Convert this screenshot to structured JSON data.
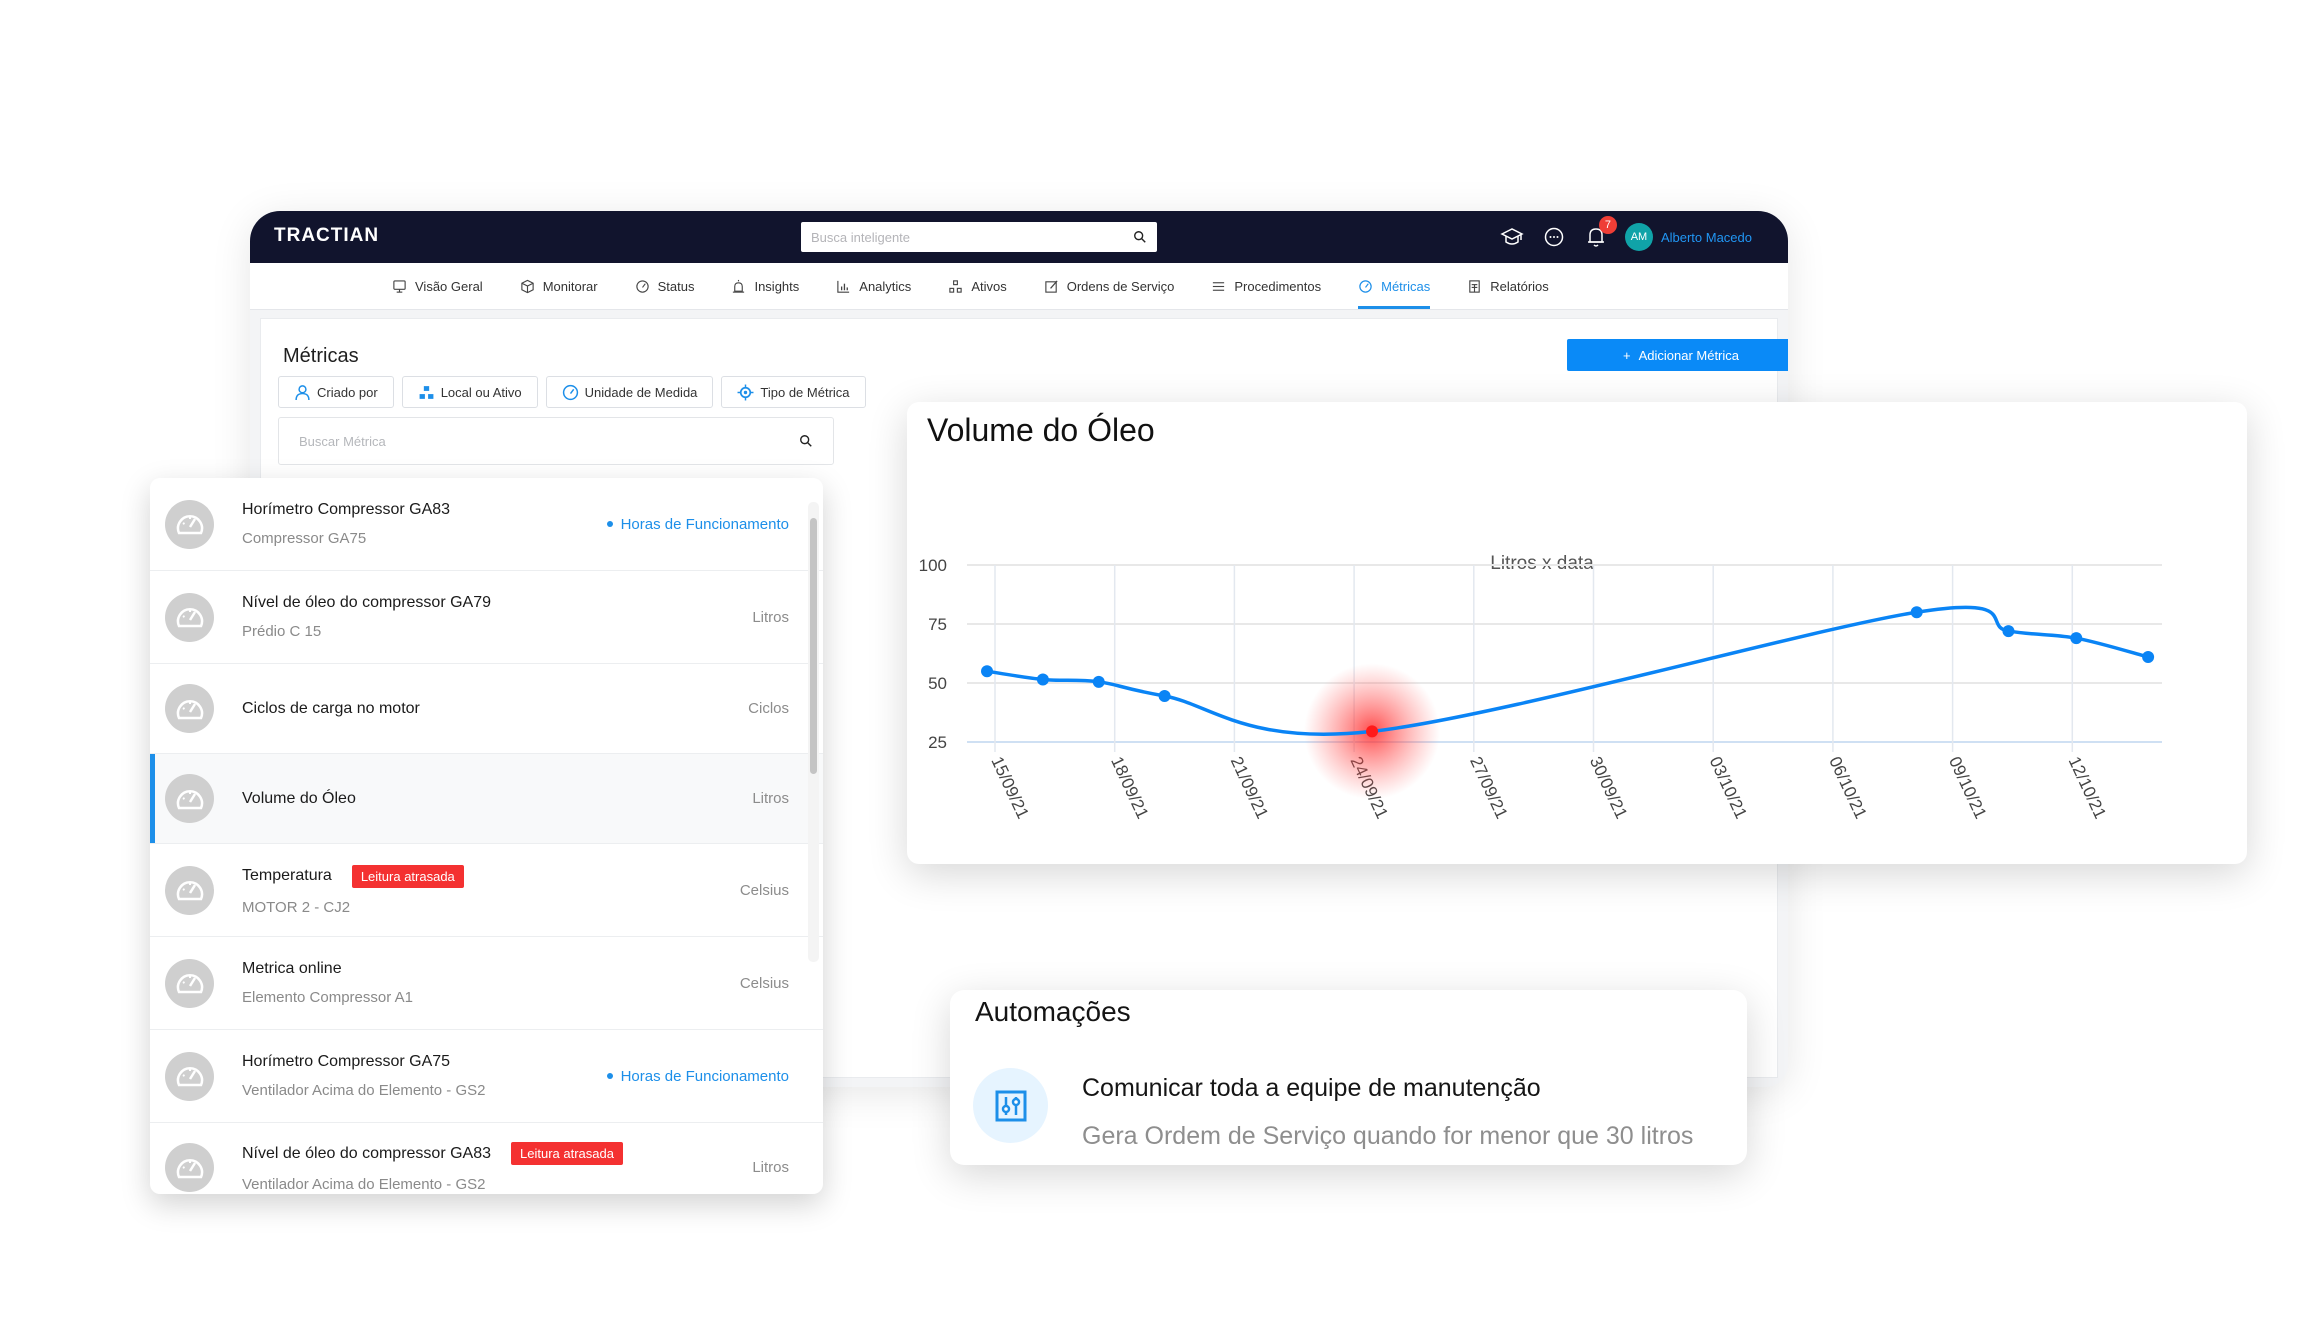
{
  "app": {
    "logo": "TRACTIAN",
    "search_placeholder": "Busca inteligente",
    "notifications_count": "7",
    "user_initials": "AM",
    "user_name": "Alberto Macedo"
  },
  "nav": [
    {
      "label": "Visão Geral",
      "icon": "monitor-icon"
    },
    {
      "label": "Monitorar",
      "icon": "cube-icon"
    },
    {
      "label": "Status",
      "icon": "gauge-icon"
    },
    {
      "label": "Insights",
      "icon": "alarm-icon"
    },
    {
      "label": "Analytics",
      "icon": "bar-chart-icon"
    },
    {
      "label": "Ativos",
      "icon": "hierarchy-icon"
    },
    {
      "label": "Ordens de Serviço",
      "icon": "edit-icon"
    },
    {
      "label": "Procedimentos",
      "icon": "list-icon"
    },
    {
      "label": "Métricas",
      "icon": "gauge-icon",
      "active": true
    },
    {
      "label": "Relatórios",
      "icon": "report-icon"
    }
  ],
  "page": {
    "title": "Métricas",
    "add_button": "Adicionar Métrica",
    "filters": [
      "Criado por",
      "Local ou Ativo",
      "Unidade de Medida",
      "Tipo de Métrica"
    ],
    "search_placeholder": "Buscar Métrica"
  },
  "metrics": [
    {
      "title": "Horímetro Compressor GA83",
      "subtitle": "Compressor GA75",
      "unit": "Horas de Funcionamento",
      "unit_highlight": true,
      "late": ""
    },
    {
      "title": "Nível de óleo do compressor GA79",
      "subtitle": "Prédio C 15",
      "unit": "Litros",
      "unit_highlight": false,
      "late": ""
    },
    {
      "title": "Ciclos de carga no motor",
      "subtitle": "",
      "unit": "Ciclos",
      "unit_highlight": false,
      "late": ""
    },
    {
      "title": "Volume do Óleo",
      "subtitle": "",
      "unit": "Litros",
      "unit_highlight": false,
      "late": "",
      "selected": true
    },
    {
      "title": "Temperatura",
      "subtitle": "MOTOR 2 - CJ2",
      "unit": "Celsius",
      "unit_highlight": false,
      "late": "Leitura atrasada"
    },
    {
      "title": "Metrica online",
      "subtitle": "Elemento Compressor A1",
      "unit": "Celsius",
      "unit_highlight": false,
      "late": ""
    },
    {
      "title": "Horímetro Compressor GA75",
      "subtitle": "Ventilador Acima do Elemento - GS2",
      "unit": "Horas de Funcionamento",
      "unit_highlight": true,
      "late": ""
    },
    {
      "title": "Nível de óleo do compressor GA83",
      "subtitle": "Ventilador Acima do Elemento - GS2",
      "unit": "Litros",
      "unit_highlight": false,
      "late": "Leitura atrasada"
    }
  ],
  "chart_card": {
    "title": "Volume do Óleo"
  },
  "chart_data": {
    "type": "line",
    "title": "Litros x data",
    "xlabel": "",
    "ylabel": "",
    "ylim": [
      25,
      100
    ],
    "yticks": [
      100,
      75,
      50,
      25
    ],
    "x_unit": "days since 15/09/21",
    "xlim": [
      0,
      31
    ],
    "xticks": [
      {
        "day": 0,
        "label": "15/09/21"
      },
      {
        "day": 3,
        "label": "18/09/21"
      },
      {
        "day": 6,
        "label": "21/09/21"
      },
      {
        "day": 9,
        "label": "24/09/21"
      },
      {
        "day": 12,
        "label": "27/09/21"
      },
      {
        "day": 15,
        "label": "30/09/21"
      },
      {
        "day": 18,
        "label": "03/10/21"
      },
      {
        "day": 21,
        "label": "06/10/21"
      },
      {
        "day": 24,
        "label": "09/10/21"
      },
      {
        "day": 27,
        "label": "12/10/21"
      }
    ],
    "grid": true,
    "series": [
      {
        "name": "Litros",
        "color": "#0a84f5",
        "points": [
          {
            "x": -0.2,
            "y": 55
          },
          {
            "x": 1.2,
            "y": 51.5
          },
          {
            "x": 2.6,
            "y": 50.5
          },
          {
            "x": 4.25,
            "y": 44.5
          },
          {
            "x": 9.45,
            "y": 29.5,
            "highlight": true
          },
          {
            "x": 23.1,
            "y": 80
          },
          {
            "x": 25.4,
            "y": 72
          },
          {
            "x": 27.1,
            "y": 69
          },
          {
            "x": 28.9,
            "y": 61
          }
        ]
      }
    ],
    "highlight_color": "#ff1a1a"
  },
  "automations": {
    "title": "Automações",
    "item_title": "Comunicar toda a equipe de manutenção",
    "item_subtitle": "Gera Ordem de Serviço quando for menor que 30 litros"
  }
}
